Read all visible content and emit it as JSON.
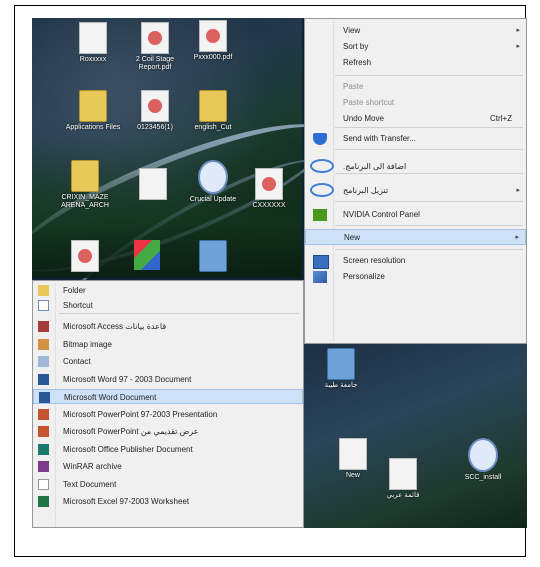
{
  "desktop": {
    "icons": [
      {
        "name": "file-icon-1",
        "label": "Roxxxxx",
        "kind": "doc plain"
      },
      {
        "name": "file-icon-2",
        "label": "2 Coil Stage Report.pdf",
        "kind": "doc"
      },
      {
        "name": "file-icon-3",
        "label": "Pxxx000.pdf",
        "kind": "doc"
      },
      {
        "name": "file-icon-4",
        "label": "Applications Files",
        "kind": "folder"
      },
      {
        "name": "file-icon-5",
        "label": "0123456(1)",
        "kind": "doc"
      },
      {
        "name": "file-icon-6",
        "label": "english_Cut",
        "kind": "folder"
      },
      {
        "name": "file-icon-7",
        "label": "CRIXIN_MAZE ARENA_ARCH",
        "kind": "folder"
      },
      {
        "name": "file-icon-8",
        "label": "",
        "kind": "doc plain"
      },
      {
        "name": "file-icon-9",
        "label": "Crucial Update",
        "kind": "setup"
      },
      {
        "name": "file-icon-10",
        "label": "CXXXXXX",
        "kind": "doc"
      },
      {
        "name": "file-icon-11",
        "label": "",
        "kind": "doc"
      },
      {
        "name": "file-icon-12",
        "label": "",
        "kind": "multi"
      },
      {
        "name": "file-icon-13",
        "label": "",
        "kind": "folder blue"
      }
    ],
    "lower_icons": [
      {
        "name": "shortcut-icon",
        "label": "جامعة طيبة",
        "kind": "folder blue"
      },
      {
        "name": "doc-icon",
        "label": "New",
        "kind": "doc plain"
      },
      {
        "name": "archive-icon",
        "label": "قائمة عربي",
        "kind": "doc plain"
      },
      {
        "name": "setup-icon",
        "label": "SCC_install",
        "kind": "setup"
      }
    ]
  },
  "context_menu": {
    "items": [
      {
        "label": "View",
        "arrow": "▸",
        "disabled": false
      },
      {
        "label": "Sort by",
        "arrow": "▸",
        "disabled": false
      },
      {
        "label": "Refresh",
        "arrow": "",
        "disabled": false
      },
      {
        "label": "Paste",
        "arrow": "",
        "disabled": true
      },
      {
        "label": "Paste shortcut",
        "arrow": "",
        "disabled": true
      },
      {
        "label": "Undo Move",
        "shortcut": "Ctrl+Z",
        "disabled": false
      },
      {
        "label": "Send with Transfer...",
        "icon": "shield"
      },
      {
        "label": ".اضافة الى البرنامج",
        "icon": "ie"
      },
      {
        "label": "تنزيل البرنامج",
        "icon": "ie",
        "arrow": "▸"
      },
      {
        "label": "NVIDIA Control Panel",
        "icon": "nv"
      },
      {
        "label": "New",
        "arrow": "▸",
        "highlighted": true
      },
      {
        "label": "Screen resolution",
        "icon": "screen"
      },
      {
        "label": "Personalize",
        "icon": "pers"
      }
    ]
  },
  "new_submenu": {
    "items": [
      {
        "label": "Folder",
        "icon": "folder"
      },
      {
        "label": "Shortcut",
        "icon": "short"
      },
      {
        "label": "Microsoft Access قاعدة بيانات",
        "icon": "access"
      },
      {
        "label": "Bitmap image",
        "icon": "bmp"
      },
      {
        "label": "Contact",
        "icon": "contact"
      },
      {
        "label": "Microsoft Word 97 - 2003 Document",
        "icon": "word"
      },
      {
        "label": "Microsoft Word Document",
        "icon": "word",
        "highlighted": true
      },
      {
        "label": "Microsoft PowerPoint 97-2003 Presentation",
        "icon": "ppt"
      },
      {
        "label": "Microsoft PowerPoint عرض تقديمي من",
        "icon": "ppt"
      },
      {
        "label": "Microsoft Office Publisher Document",
        "icon": "pub"
      },
      {
        "label": "WinRAR archive",
        "icon": "rar"
      },
      {
        "label": "Text Document",
        "icon": "txt"
      },
      {
        "label": "Microsoft Excel 97-2003 Worksheet",
        "icon": "xls"
      }
    ]
  }
}
